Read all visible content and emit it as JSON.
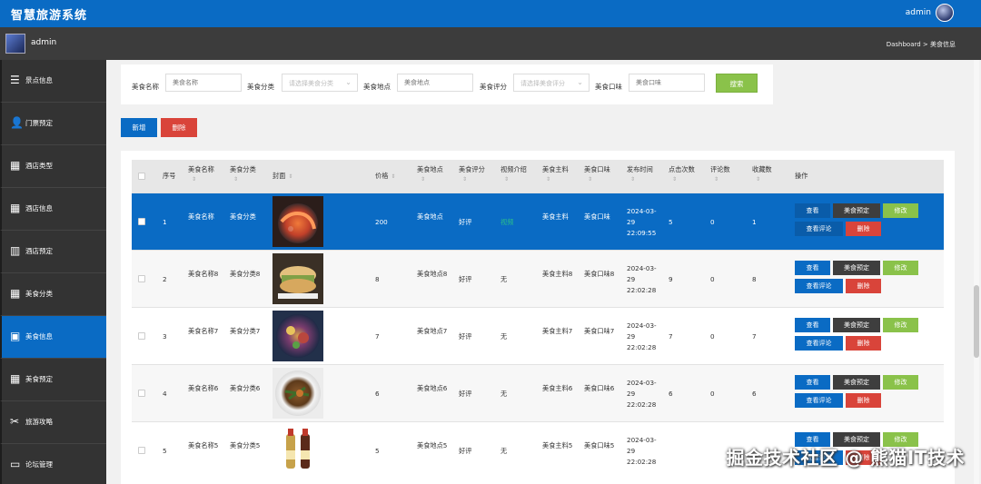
{
  "app": {
    "title": "智慧旅游系统",
    "user": "admin"
  },
  "subbar": {
    "user": "admin",
    "breadcrumb": "Dashboard > 美食信息"
  },
  "sidebar": [
    {
      "label": "景点信息",
      "icon": "list-icon"
    },
    {
      "label": "门票预定",
      "icon": "user-icon"
    },
    {
      "label": "酒店类型",
      "icon": "grid-icon"
    },
    {
      "label": "酒店信息",
      "icon": "grid-icon"
    },
    {
      "label": "酒店预定",
      "icon": "columns-icon"
    },
    {
      "label": "美食分类",
      "icon": "grid-icon"
    },
    {
      "label": "美食信息",
      "icon": "wallet-icon",
      "active": true
    },
    {
      "label": "美食预定",
      "icon": "grid-icon"
    },
    {
      "label": "旅游攻略",
      "icon": "ticket-icon"
    },
    {
      "label": "论坛管理",
      "icon": "monitor-icon"
    }
  ],
  "search": {
    "name_label": "美食名称",
    "name_placeholder": "美食名称",
    "category_label": "美食分类",
    "category_placeholder": "请选择美食分类",
    "location_label": "美食地点",
    "location_placeholder": "美食地点",
    "rating_label": "美食评分",
    "rating_placeholder": "请选择美食评分",
    "taste_label": "美食口味",
    "taste_placeholder": "美食口味",
    "search_button": "搜索"
  },
  "toolbar": {
    "add": "新增",
    "delete": "删除"
  },
  "table": {
    "headers": {
      "index": "序号",
      "name": "美食名称",
      "category": "美食分类",
      "cover": "封面",
      "price": "价格",
      "location": "美食地点",
      "rating": "美食评分",
      "video": "视频介绍",
      "ingredient": "美食主料",
      "taste": "美食口味",
      "published": "发布时间",
      "clicks": "点击次数",
      "comments": "评论数",
      "favorites": "收藏数",
      "actions": "操作"
    },
    "sort_glyph": "⇕",
    "rows": [
      {
        "index": "1",
        "name": "美食名称",
        "category": "美食分类",
        "price": "200",
        "location": "美食地点",
        "rating": "好评",
        "video": "视频",
        "ingredient": "美食主料",
        "taste": "美食口味",
        "published": "2024-03-29 22:09:55",
        "clicks": "5",
        "comments": "0",
        "favorites": "1"
      },
      {
        "index": "2",
        "name": "美食名称8",
        "category": "美食分类8",
        "price": "8",
        "location": "美食地点8",
        "rating": "好评",
        "video": "无",
        "ingredient": "美食主料8",
        "taste": "美食口味8",
        "published": "2024-03-29 22:02:28",
        "clicks": "9",
        "comments": "0",
        "favorites": "8"
      },
      {
        "index": "3",
        "name": "美食名称7",
        "category": "美食分类7",
        "price": "7",
        "location": "美食地点7",
        "rating": "好评",
        "video": "无",
        "ingredient": "美食主料7",
        "taste": "美食口味7",
        "published": "2024-03-29 22:02:28",
        "clicks": "7",
        "comments": "0",
        "favorites": "7"
      },
      {
        "index": "4",
        "name": "美食名称6",
        "category": "美食分类6",
        "price": "6",
        "location": "美食地点6",
        "rating": "好评",
        "video": "无",
        "ingredient": "美食主料6",
        "taste": "美食口味6",
        "published": "2024-03-29 22:02:28",
        "clicks": "6",
        "comments": "0",
        "favorites": "6"
      },
      {
        "index": "5",
        "name": "美食名称5",
        "category": "美食分类5",
        "price": "5",
        "location": "美食地点5",
        "rating": "好评",
        "video": "无",
        "ingredient": "美食主料5",
        "taste": "美食口味5",
        "published": "2024-03-29 22:02:28",
        "clicks": "",
        "comments": "",
        "favorites": ""
      }
    ],
    "actions": {
      "view": "查看",
      "book": "美食预定",
      "edit": "修改",
      "comments": "查看评论",
      "delete": "删除"
    }
  },
  "watermark": "掘金技术社区 @ 熊猫IT技术",
  "colors": {
    "primary": "#0a6bc4",
    "sidebar": "#333333",
    "danger": "#d9443a",
    "success": "#8ac24a",
    "dark": "#3e3e3e"
  }
}
